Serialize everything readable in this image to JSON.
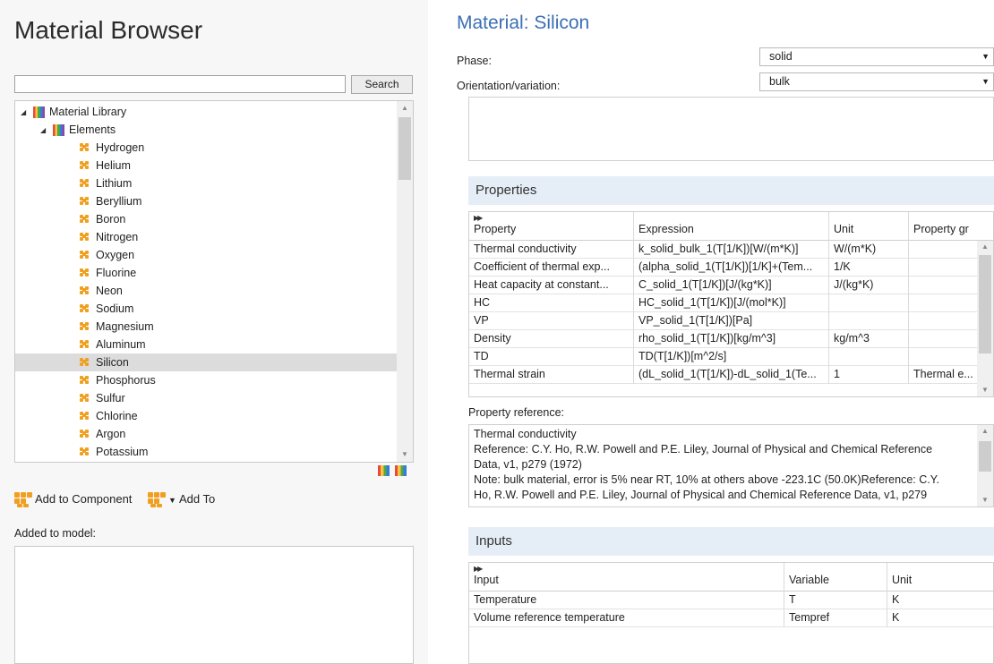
{
  "browser": {
    "title": "Material Browser",
    "search_value": "",
    "search_button": "Search",
    "tree": {
      "library_label": "Material Library",
      "elements_label": "Elements",
      "elements": [
        "Hydrogen",
        "Helium",
        "Lithium",
        "Beryllium",
        "Boron",
        "Nitrogen",
        "Oxygen",
        "Fluorine",
        "Neon",
        "Sodium",
        "Magnesium",
        "Aluminum",
        "Silicon",
        "Phosphorus",
        "Sulfur",
        "Chlorine",
        "Argon",
        "Potassium"
      ],
      "selected": "Silicon"
    },
    "add_to_component": "Add to Component",
    "add_to": "Add To",
    "added_label": "Added to model:"
  },
  "material": {
    "title": "Material: Silicon",
    "phase_label": "Phase:",
    "phase_value": "solid",
    "orientation_label": "Orientation/variation:",
    "orientation_value": "bulk"
  },
  "properties": {
    "heading": "Properties",
    "columns": [
      "Property",
      "Expression",
      "Unit",
      "Property gr"
    ],
    "rows": [
      [
        "Thermal conductivity",
        "k_solid_bulk_1(T[1/K])[W/(m*K)]",
        "W/(m*K)",
        ""
      ],
      [
        "Coefficient of thermal exp...",
        "(alpha_solid_1(T[1/K])[1/K]+(Tem...",
        "1/K",
        ""
      ],
      [
        "Heat capacity at constant...",
        "C_solid_1(T[1/K])[J/(kg*K)]",
        "J/(kg*K)",
        ""
      ],
      [
        "HC",
        "HC_solid_1(T[1/K])[J/(mol*K)]",
        "",
        ""
      ],
      [
        "VP",
        "VP_solid_1(T[1/K])[Pa]",
        "",
        ""
      ],
      [
        "Density",
        "rho_solid_1(T[1/K])[kg/m^3]",
        "kg/m^3",
        ""
      ],
      [
        "TD",
        "TD(T[1/K])[m^2/s]",
        "",
        ""
      ],
      [
        "Thermal strain",
        "(dL_solid_1(T[1/K])-dL_solid_1(Te...",
        "1",
        "Thermal e..."
      ]
    ]
  },
  "reference": {
    "label": "Property reference:",
    "lines": [
      "Thermal conductivity",
      "Reference: C.Y. Ho, R.W. Powell and P.E. Liley, Journal of Physical and Chemical Reference",
      "Data, v1, p279 (1972)",
      "Note: bulk material, error is 5% near RT, 10% at others above -223.1C (50.0K)Reference: C.Y.",
      "Ho, R.W. Powell and P.E. Liley, Journal of Physical and Chemical Reference Data, v1, p279"
    ]
  },
  "inputs": {
    "heading": "Inputs",
    "columns": [
      "Input",
      "Variable",
      "Unit"
    ],
    "rows": [
      [
        "Temperature",
        "T",
        "K"
      ],
      [
        "Volume reference temperature",
        "Tempref",
        "K"
      ]
    ]
  }
}
